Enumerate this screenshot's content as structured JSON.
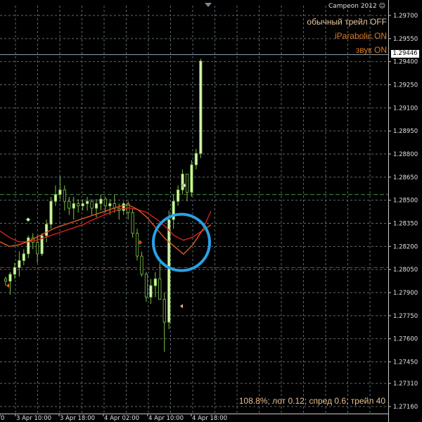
{
  "chart": {
    "watermark": "Campeon 2012",
    "watermark_icon": "smiley-icon",
    "indicators": [
      {
        "text": "обычный трейл OFF",
        "color": "#e8c8a0"
      },
      {
        "text": "iParabolic ON",
        "color": "#e07a1c"
      },
      {
        "text": "звук ON",
        "color": "#e07a1c"
      }
    ],
    "current_price": "1.29446",
    "status_line": "108.8%; лот 0.12; спред 0.6; трейл 40",
    "price_axis": [
      "1.29700",
      "1.29550",
      "1.29400",
      "1.29250",
      "1.29100",
      "1.28950",
      "1.28800",
      "1.28650",
      "1.28500",
      "1.28350",
      "1.28200",
      "1.28050",
      "1.27900",
      "1.27750",
      "1.27600",
      "1.27450",
      "1.27310",
      "1.27160"
    ],
    "time_axis": [
      "0",
      "3 Apr 10:00",
      "3 Apr 18:00",
      "4 Apr 02:00",
      "4 Apr 10:00",
      "4 Apr 18:00"
    ],
    "colors": {
      "background": "#000000",
      "grid": "#5a6a70",
      "bull_candle": "#d7f5b0",
      "bear_candle": "#000000",
      "wick": "#7fc24a",
      "ma_red": "#d81e1e",
      "ma_orange": "#e05a1a",
      "line_green": "#3e8e3e",
      "line_red": "#cc2222",
      "line_current": "#8ea8b8",
      "circle": "#27a2e6"
    }
  },
  "chart_data": {
    "type": "candlestick",
    "title": "",
    "xlabel": "",
    "ylabel": "",
    "ylim": [
      1.27127,
      1.29756
    ],
    "x": [
      "3 Apr 10:00",
      "3 Apr 18:00",
      "4 Apr 02:00",
      "4 Apr 10:00",
      "4 Apr 18:00"
    ],
    "candles": [
      {
        "o": 1.27989,
        "h": 1.28004,
        "l": 1.27945,
        "c": 1.27974
      },
      {
        "o": 1.27974,
        "h": 1.28034,
        "l": 1.27886,
        "c": 1.28019
      },
      {
        "o": 1.28019,
        "h": 1.28093,
        "l": 1.27989,
        "c": 1.28063
      },
      {
        "o": 1.28063,
        "h": 1.28167,
        "l": 1.28004,
        "c": 1.28108
      },
      {
        "o": 1.28108,
        "h": 1.28182,
        "l": 1.28078,
        "c": 1.28152
      },
      {
        "o": 1.28152,
        "h": 1.2827,
        "l": 1.28123,
        "c": 1.28256
      },
      {
        "o": 1.28256,
        "h": 1.28285,
        "l": 1.28182,
        "c": 1.28226
      },
      {
        "o": 1.28226,
        "h": 1.2827,
        "l": 1.28093,
        "c": 1.28152
      },
      {
        "o": 1.28152,
        "h": 1.28285,
        "l": 1.28137,
        "c": 1.2827
      },
      {
        "o": 1.2827,
        "h": 1.28374,
        "l": 1.28226,
        "c": 1.28344
      },
      {
        "o": 1.28344,
        "h": 1.28522,
        "l": 1.28315,
        "c": 1.28493
      },
      {
        "o": 1.28493,
        "h": 1.28596,
        "l": 1.28463,
        "c": 1.28537
      },
      {
        "o": 1.28537,
        "h": 1.28655,
        "l": 1.28507,
        "c": 1.28567
      },
      {
        "o": 1.28567,
        "h": 1.28596,
        "l": 1.28433,
        "c": 1.28493
      },
      {
        "o": 1.28493,
        "h": 1.28522,
        "l": 1.28404,
        "c": 1.28448
      },
      {
        "o": 1.28448,
        "h": 1.28522,
        "l": 1.28374,
        "c": 1.28478
      },
      {
        "o": 1.28478,
        "h": 1.28507,
        "l": 1.28419,
        "c": 1.28463
      },
      {
        "o": 1.28463,
        "h": 1.28507,
        "l": 1.28433,
        "c": 1.28478
      },
      {
        "o": 1.28478,
        "h": 1.28522,
        "l": 1.28433,
        "c": 1.28493
      },
      {
        "o": 1.28493,
        "h": 1.28507,
        "l": 1.28404,
        "c": 1.28448
      },
      {
        "o": 1.28448,
        "h": 1.28507,
        "l": 1.28389,
        "c": 1.28478
      },
      {
        "o": 1.28478,
        "h": 1.28537,
        "l": 1.28433,
        "c": 1.28507
      },
      {
        "o": 1.28507,
        "h": 1.28522,
        "l": 1.28419,
        "c": 1.28463
      },
      {
        "o": 1.28463,
        "h": 1.28507,
        "l": 1.28404,
        "c": 1.28478
      },
      {
        "o": 1.28478,
        "h": 1.28537,
        "l": 1.28419,
        "c": 1.28448
      },
      {
        "o": 1.28448,
        "h": 1.28478,
        "l": 1.28374,
        "c": 1.28433
      },
      {
        "o": 1.28433,
        "h": 1.28493,
        "l": 1.28404,
        "c": 1.28478
      },
      {
        "o": 1.28478,
        "h": 1.28493,
        "l": 1.28374,
        "c": 1.28419
      },
      {
        "o": 1.28419,
        "h": 1.28448,
        "l": 1.28256,
        "c": 1.28285
      },
      {
        "o": 1.28285,
        "h": 1.28315,
        "l": 1.28108,
        "c": 1.28137
      },
      {
        "o": 1.28137,
        "h": 1.28167,
        "l": 1.28004,
        "c": 1.28019
      },
      {
        "o": 1.28019,
        "h": 1.28034,
        "l": 1.27841,
        "c": 1.27871
      },
      {
        "o": 1.27871,
        "h": 1.27989,
        "l": 1.27827,
        "c": 1.27945
      },
      {
        "o": 1.27945,
        "h": 1.28034,
        "l": 1.27871,
        "c": 1.27989
      },
      {
        "o": 1.27989,
        "h": 1.28093,
        "l": 1.2793,
        "c": 1.27856
      },
      {
        "o": 1.27856,
        "h": 1.279,
        "l": 1.27515,
        "c": 1.27708
      },
      {
        "o": 1.27708,
        "h": 1.28433,
        "l": 1.27663,
        "c": 1.28374
      },
      {
        "o": 1.28374,
        "h": 1.28537,
        "l": 1.28315,
        "c": 1.28493
      },
      {
        "o": 1.28493,
        "h": 1.28596,
        "l": 1.28463,
        "c": 1.28567
      },
      {
        "o": 1.28567,
        "h": 1.287,
        "l": 1.28537,
        "c": 1.2867
      },
      {
        "o": 1.2867,
        "h": 1.28567,
        "l": 1.28493,
        "c": 1.28552
      },
      {
        "o": 1.28552,
        "h": 1.28759,
        "l": 1.28522,
        "c": 1.2873
      },
      {
        "o": 1.2873,
        "h": 1.28833,
        "l": 1.287,
        "c": 1.28804
      },
      {
        "o": 1.28804,
        "h": 1.29419,
        "l": 1.28774,
        "c": 1.29404
      }
    ],
    "moving_averages": [
      {
        "name": "",
        "color": "#d81e1e",
        "values": [
          1.283,
          1.2826,
          1.2823,
          1.2823,
          1.2824,
          1.2826,
          1.2828,
          1.283,
          1.2832,
          1.2834,
          1.2837,
          1.28395,
          1.2842,
          1.2844,
          1.2845,
          1.2844,
          1.2842,
          1.2838,
          1.2833,
          1.2827,
          1.2824,
          1.2826,
          1.283,
          1.2843
        ]
      },
      {
        "name": "",
        "color": "#e05a1a",
        "values": [
          1.2823,
          1.282,
          1.2821,
          1.2823,
          1.2826,
          1.2829,
          1.2832,
          1.2834,
          1.2836,
          1.2838,
          1.284,
          1.2842,
          1.2844,
          1.2846,
          1.2847,
          1.2844,
          1.2839,
          1.2832,
          1.2825,
          1.282,
          1.2815,
          1.2821,
          1.283,
          1.2834
        ]
      }
    ],
    "horizontal_lines": [
      {
        "price": 1.28537,
        "style": "dashed",
        "color": "#3e8e3e"
      },
      {
        "price": 1.28063,
        "style": "dashed",
        "color": "#cc2222"
      },
      {
        "price": 1.29446,
        "style": "solid",
        "color": "#8ea8b8"
      }
    ],
    "signals": [
      {
        "type": "up",
        "price": 1.27945,
        "color": "#e07a1c"
      },
      {
        "type": "entry",
        "price": 1.28374,
        "color": "#d7f5b0"
      },
      {
        "type": "entry",
        "price": 1.28226,
        "color": "#ff3030"
      },
      {
        "type": "down",
        "price": 1.27812,
        "color": "#e8b090"
      },
      {
        "type": "entry",
        "price": 1.28596,
        "color": "#d7f5b0"
      }
    ],
    "annotations": [
      {
        "type": "circle",
        "price": 1.28226,
        "color": "#27a2e6"
      }
    ],
    "grid": true,
    "legend": "none"
  }
}
